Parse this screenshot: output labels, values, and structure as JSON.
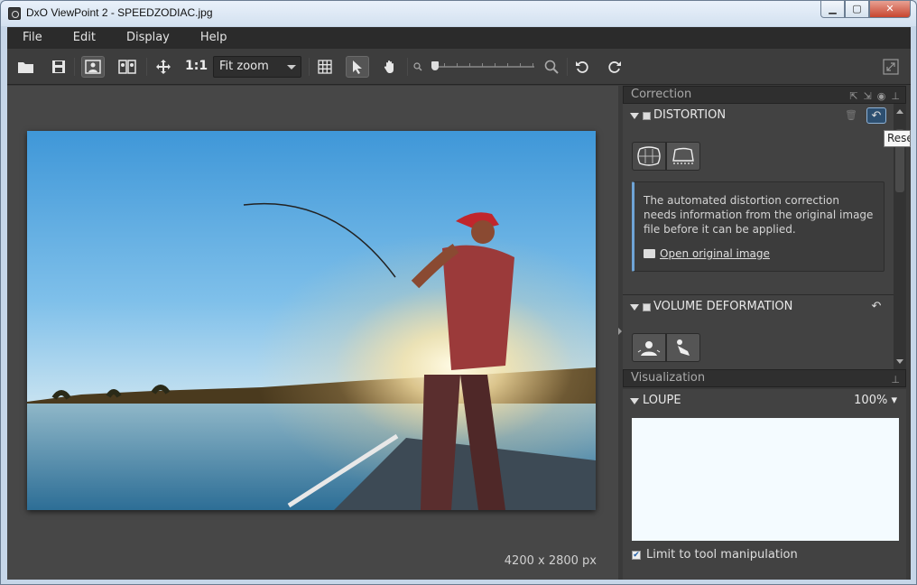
{
  "window": {
    "title": "DxO ViewPoint 2 - SPEEDZODIAC.jpg",
    "minimize": "▁",
    "maximize": "▢",
    "close": "✕"
  },
  "menu": {
    "items": [
      "File",
      "Edit",
      "Display",
      "Help"
    ]
  },
  "toolbar": {
    "one_to_one": "1:1",
    "zoom_value": "Fit zoom",
    "zoom_slider_level": 0
  },
  "viewer": {
    "image_size": "4200 x 2800 px"
  },
  "correction": {
    "title": "Correction",
    "distortion": {
      "title": "DISTORTION",
      "message": "The automated distortion correction needs information from the original image file before it can be applied.",
      "link": "Open original image"
    },
    "volume": {
      "title": "VOLUME DEFORMATION"
    }
  },
  "visualization": {
    "title": "Visualization",
    "loupe": {
      "title": "LOUPE",
      "zoom": "100%",
      "limit_label": "Limit to tool manipulation",
      "limit_checked": true
    }
  },
  "tooltip": {
    "text": "Reset"
  },
  "colors": {
    "panel_bg": "#383838",
    "accent": "#6fa4d6"
  }
}
